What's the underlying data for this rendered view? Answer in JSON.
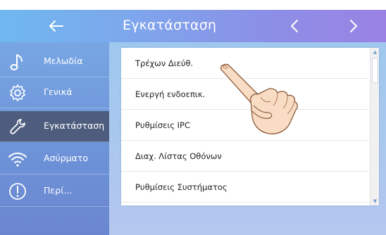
{
  "header": {
    "title": "Εγκατάσταση",
    "back_icon": "arrow-left-icon",
    "prev_icon": "chevron-left-icon",
    "next_icon": "chevron-right-icon"
  },
  "sidebar": {
    "items": [
      {
        "label": "Μελωδία",
        "icon": "music-note-icon",
        "active": false
      },
      {
        "label": "Γενικά",
        "icon": "gear-icon",
        "active": false
      },
      {
        "label": "Εγκατάσταση",
        "icon": "wrench-icon",
        "active": true
      },
      {
        "label": "Ασύρματο",
        "icon": "wifi-icon",
        "active": false
      },
      {
        "label": "Περί...",
        "icon": "info-icon",
        "active": false
      }
    ]
  },
  "menu": {
    "items": [
      {
        "label": "Τρέχων Διεύθ."
      },
      {
        "label": "Ενεργή ενδοεπικ."
      },
      {
        "label": "Ρυθμίσεις IPC"
      },
      {
        "label": "Διαχ. Λίστας Οθόνων"
      },
      {
        "label": "Ρυθμίσεις Συστήματος"
      }
    ]
  },
  "overlay": {
    "icon": "pointing-hand-icon"
  },
  "colors": {
    "active_sidebar": "#4e5d7d",
    "topbar_start": "#6fb8ef",
    "topbar_end": "#9a82e4"
  }
}
